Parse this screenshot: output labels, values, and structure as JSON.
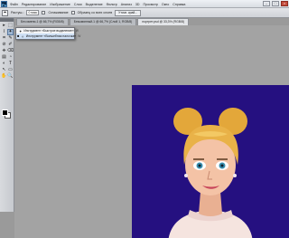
{
  "app": {
    "logo_text": "Ps"
  },
  "menubar": {
    "items": [
      "Файл",
      "Редактирование",
      "Изображение",
      "Слои",
      "Выделение",
      "Фильтр",
      "Анализ",
      "3D",
      "Просмотр",
      "Окно",
      "Справка"
    ]
  },
  "window_controls": {
    "minimize": "–",
    "maximize": "□",
    "close": "×"
  },
  "options_bar": {
    "tool_glyph": "⌖",
    "feather_label": "Растуш.:",
    "feather_value": "0 пикс",
    "antialias_label": "Сглаживание",
    "all_layers_label": "Образец со всех слоев",
    "refine_button": "Уточн. край..."
  },
  "document_tabs": [
    {
      "label": "Без имени-1 @ 66,7% (RGB/8)",
      "active": false
    },
    {
      "label": "Безымянный-1 @ 66,7% (Слой 1, RGB/8)",
      "active": false
    },
    {
      "label": "портрет.psd @ 33,3% (RGB/8)",
      "active": true
    }
  ],
  "tools": {
    "glyphs": [
      "▸",
      "⬚",
      "⌇",
      "✦",
      "⌗",
      "✎",
      "⊘",
      "✐",
      "⎈",
      "⌫",
      "▤",
      "◔",
      "◐",
      "T",
      "↖",
      "▭",
      "✋",
      "🔍"
    ]
  },
  "tool_flyout": {
    "items": [
      {
        "bullet": "",
        "icon": "✦",
        "label": "Инструмент «Быстрое выделение»",
        "key": "W",
        "selected": false
      },
      {
        "bullet": "■",
        "icon": "✧",
        "label": "Инструмент «Волшебная палочка»",
        "key": "W",
        "selected": true
      }
    ]
  },
  "colors": {
    "foreground": "#000000",
    "background": "#ffffff",
    "document_background": "#251080"
  }
}
